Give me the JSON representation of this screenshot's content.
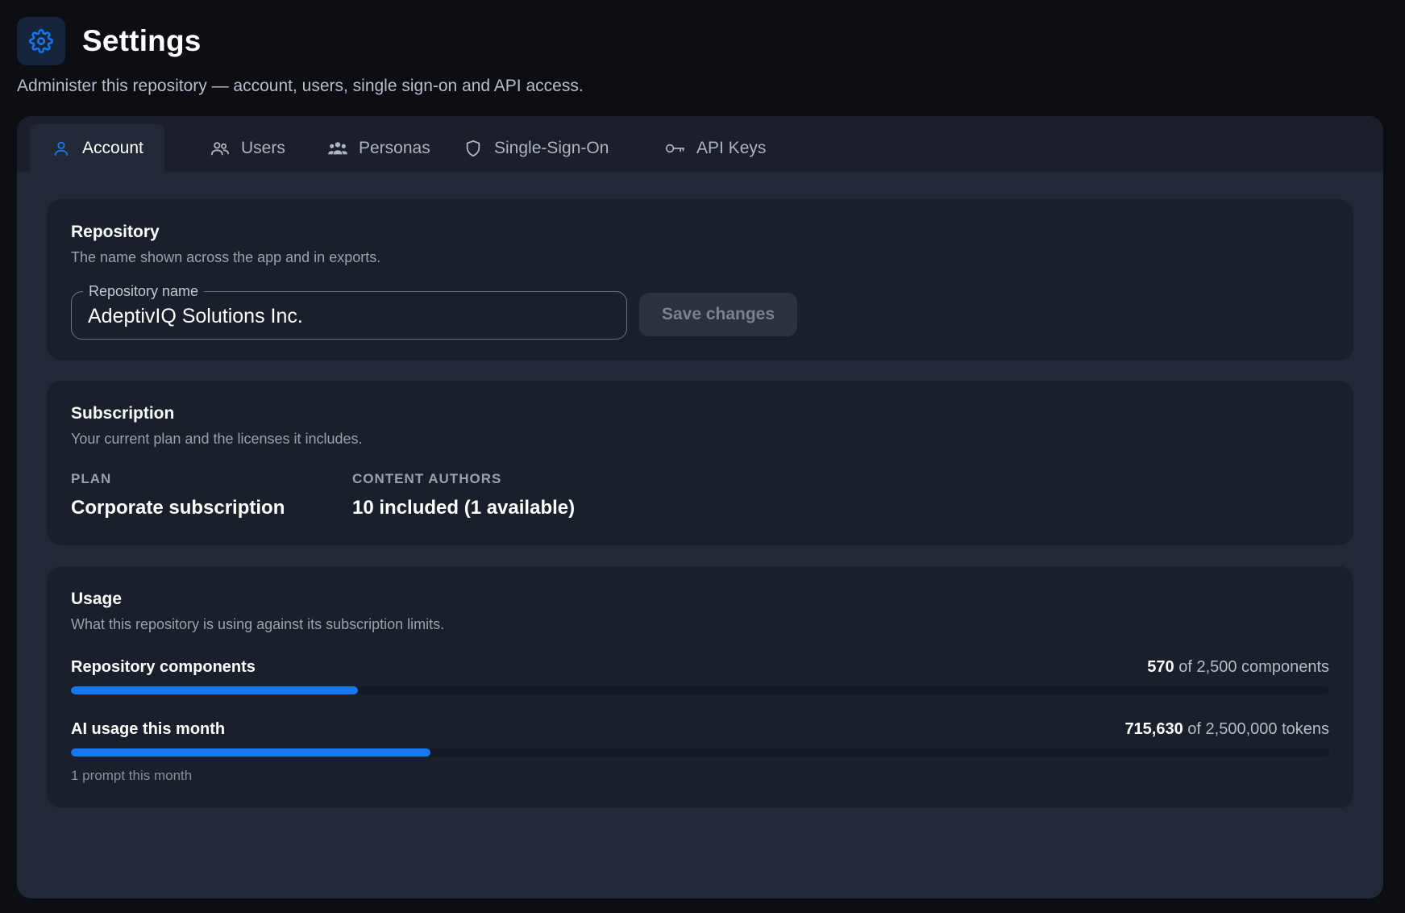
{
  "header": {
    "icon": "gear-icon",
    "title": "Settings",
    "subtitle": "Administer this repository — account, users, single sign-on and API access."
  },
  "tabs": [
    {
      "label": "Account",
      "icon": "user-icon",
      "active": true
    },
    {
      "label": "Users",
      "icon": "users-icon",
      "active": false
    },
    {
      "label": "Personas",
      "icon": "group-icon",
      "active": false
    },
    {
      "label": "Single-Sign-On",
      "icon": "shield-icon",
      "active": false
    },
    {
      "label": "API Keys",
      "icon": "key-icon",
      "active": false
    }
  ],
  "repository": {
    "title": "Repository",
    "description": "The name shown across the app and in exports.",
    "field_label": "Repository name",
    "field_value": "AdeptivIQ Solutions Inc.",
    "save_label": "Save changes"
  },
  "subscription": {
    "title": "Subscription",
    "description": "Your current plan and the licenses it includes.",
    "plan_label": "PLAN",
    "plan_value": "Corporate subscription",
    "authors_label": "CONTENT AUTHORS",
    "authors_value": "10 included (1 available)"
  },
  "usage": {
    "title": "Usage",
    "description": "What this repository is using against its subscription limits.",
    "items": [
      {
        "label": "Repository components",
        "used": "570",
        "limit_text": "of 2,500 components",
        "fraction": 0.228
      },
      {
        "label": "AI usage this month",
        "used": "715,630",
        "limit_text": "of 2,500,000 tokens",
        "fraction": 0.286
      }
    ],
    "note": "1 prompt this month"
  },
  "colors": {
    "accent": "#1677ee",
    "background": "#0c0e13",
    "panel": "#222936",
    "card": "#1a202b"
  }
}
